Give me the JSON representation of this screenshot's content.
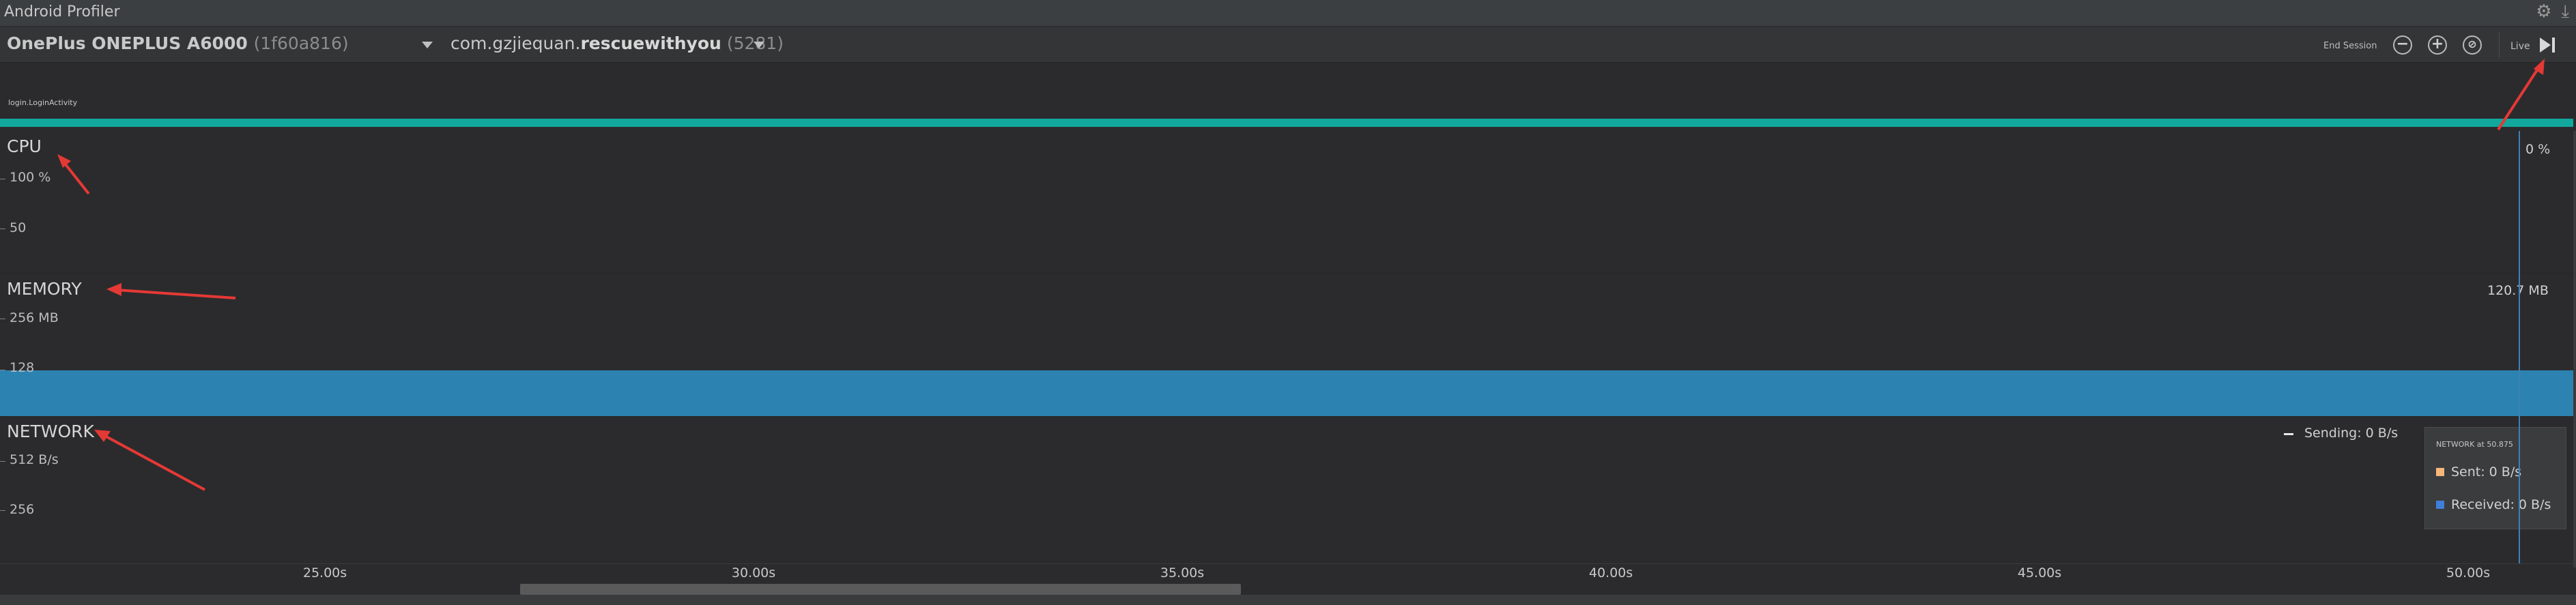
{
  "window": {
    "title": "Android Profiler"
  },
  "toolbar": {
    "device_name": "OnePlus ONEPLUS A6000",
    "device_serial": "(1f60a816)",
    "process_prefix": "com.gzjiequan.",
    "process_name": "rescuewithyou",
    "process_pid": "(5281)",
    "end_session_label": "End Session",
    "live_label": "Live",
    "zoom_out_icon": "minus-circle-icon",
    "zoom_in_icon": "plus-circle-icon",
    "reset_zoom_icon": "reset-circle-icon"
  },
  "events": {
    "activity_label": "login.LoginActivity",
    "activity_color": "#13a89e"
  },
  "cpu": {
    "title": "CPU",
    "axis_top": "100 %",
    "axis_mid": "50",
    "current_value": "0 %"
  },
  "memory": {
    "title": "MEMORY",
    "axis_top": "256 MB",
    "axis_mid": "128",
    "current_value": "120.7 MB",
    "fill_color": "#2c83b1"
  },
  "network": {
    "title": "NETWORK",
    "axis_top": "512 B/s",
    "axis_mid": "256",
    "legend_sending": "Sending: 0 B/s",
    "tooltip": {
      "title": "NETWORK at 50.875",
      "sent": "Sent: 0 B/s",
      "received": "Received: 0 B/s",
      "sent_color": "#f5b77a",
      "received_color": "#3f7fd8"
    }
  },
  "time_axis": {
    "ticks": [
      "25.00s",
      "30.00s",
      "35.00s",
      "40.00s",
      "45.00s",
      "50.00s"
    ]
  },
  "annotation_color": "#e53935"
}
